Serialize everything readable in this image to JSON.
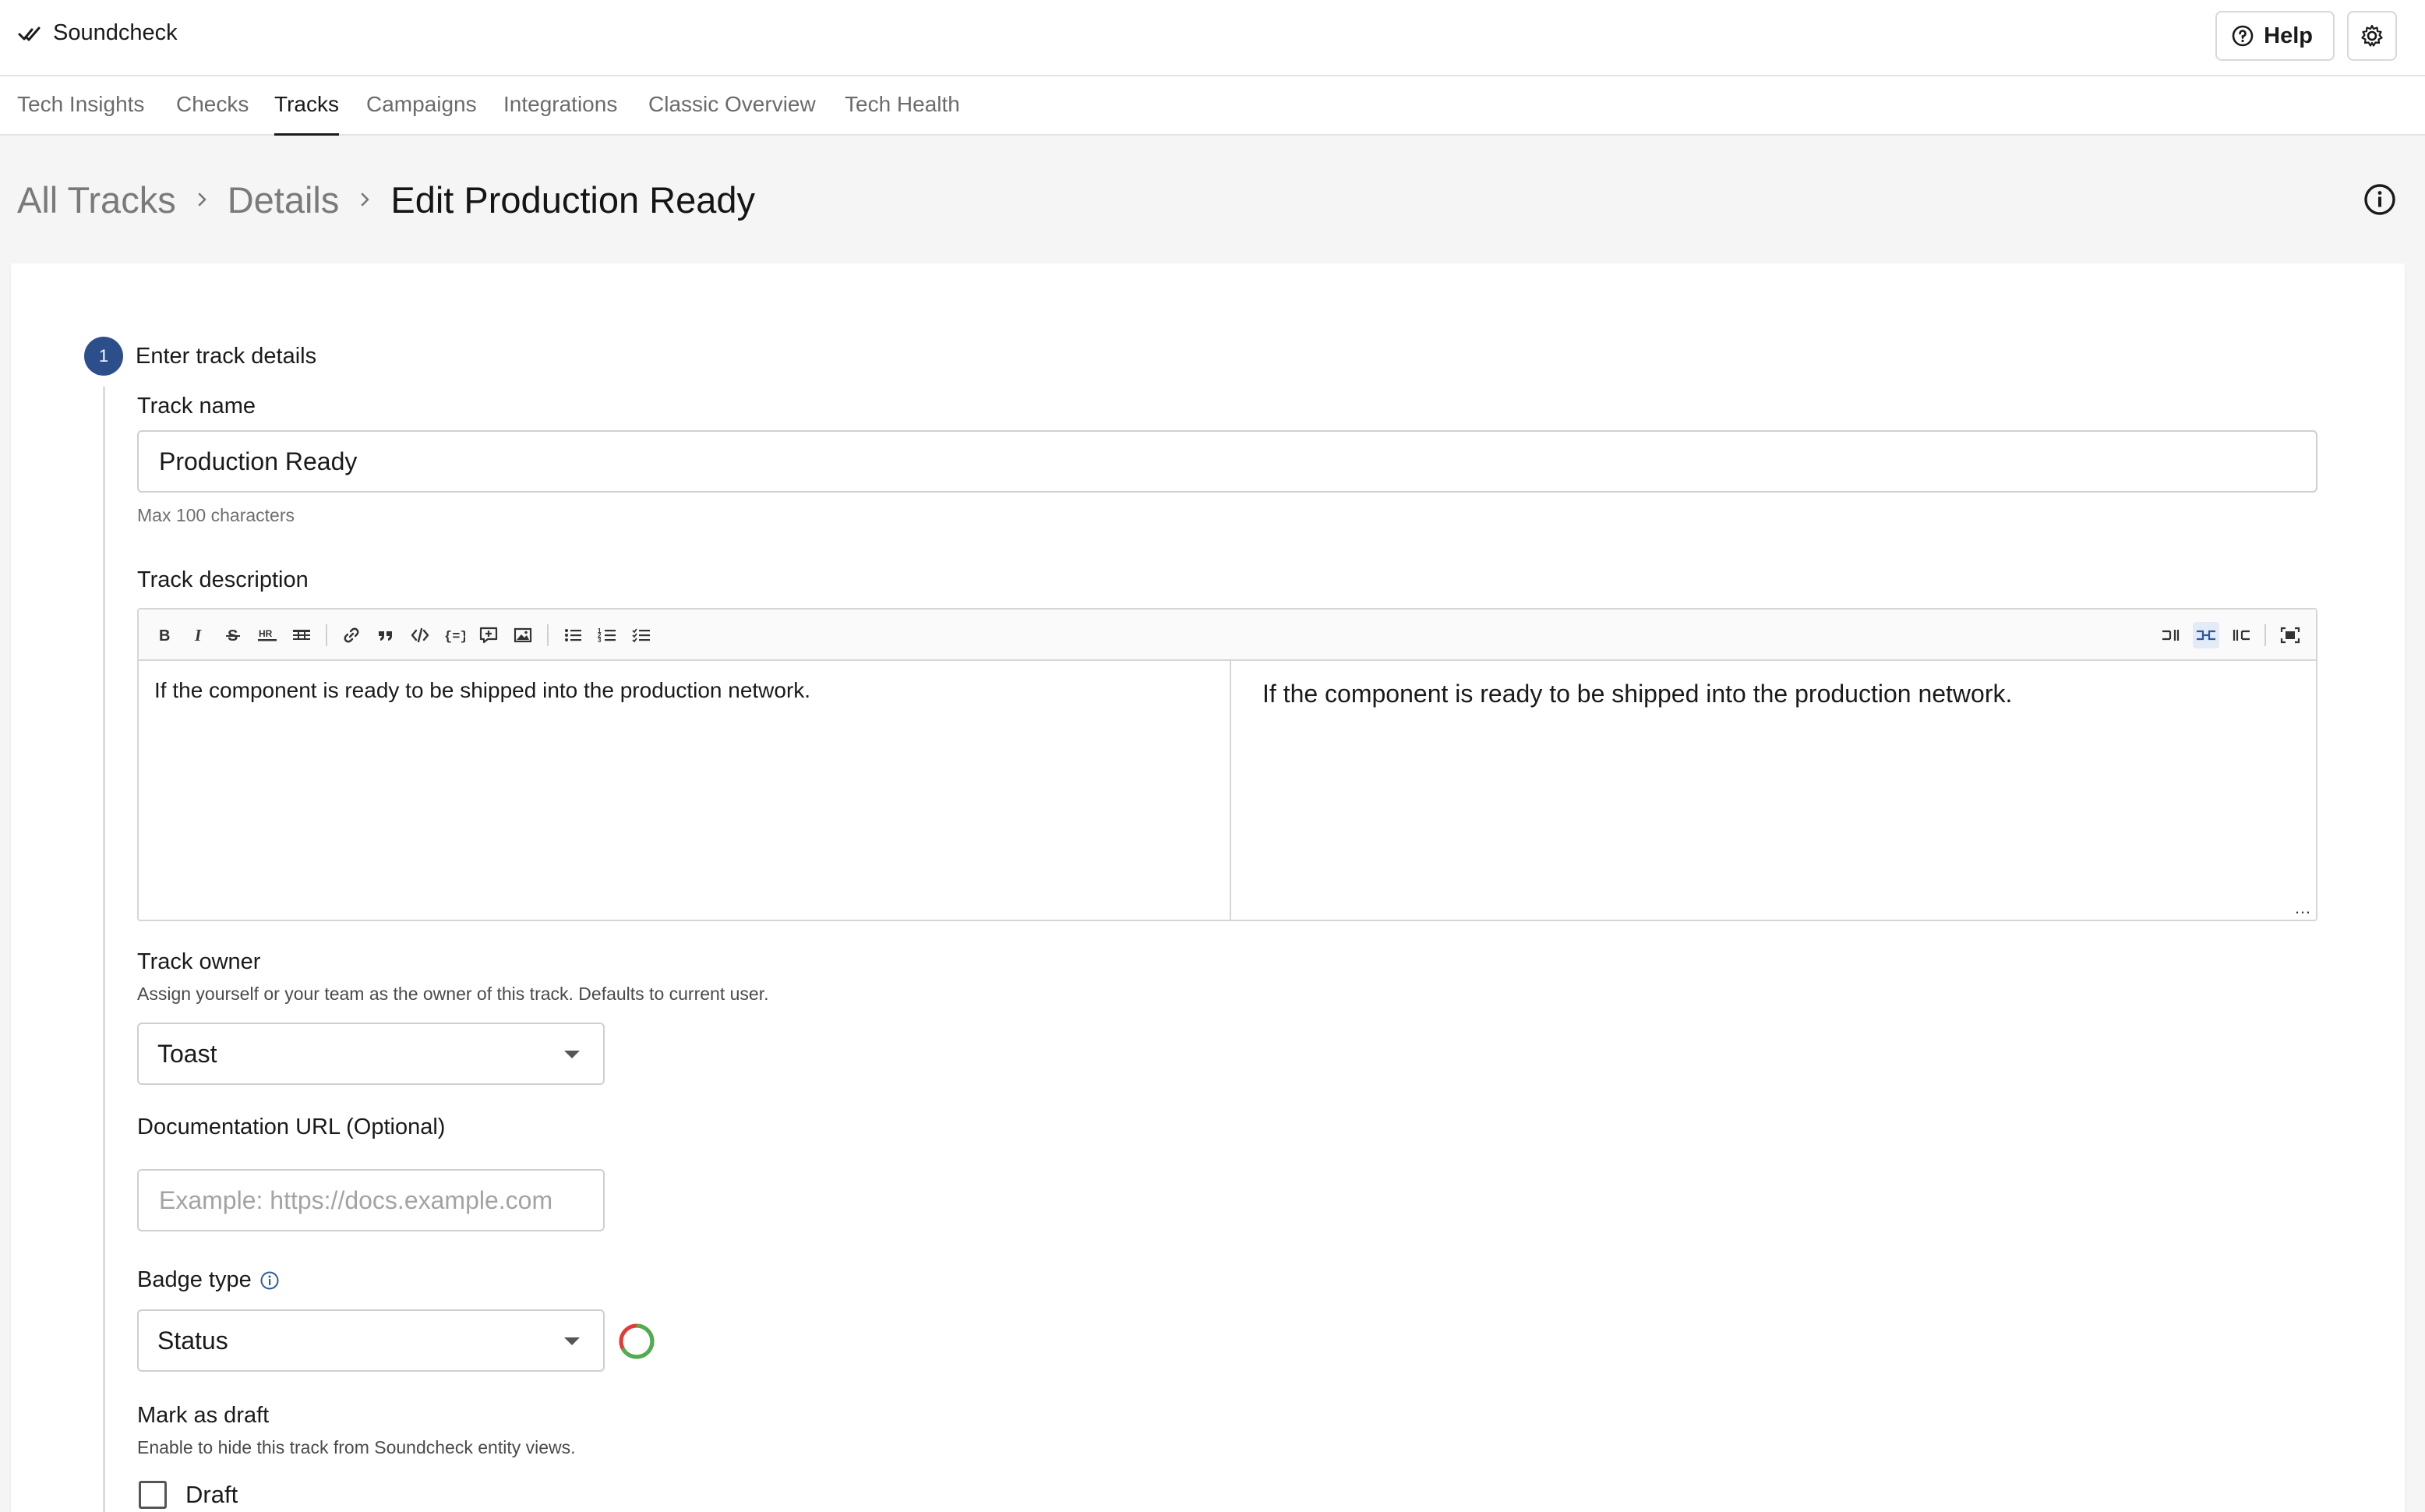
{
  "app": {
    "title": "Soundcheck",
    "help_label": "Help"
  },
  "tabs": [
    {
      "label": "Tech Insights",
      "active": false
    },
    {
      "label": "Checks",
      "active": false
    },
    {
      "label": "Tracks",
      "active": true
    },
    {
      "label": "Campaigns",
      "active": false
    },
    {
      "label": "Integrations",
      "active": false
    },
    {
      "label": "Classic Overview",
      "active": false
    },
    {
      "label": "Tech Health",
      "active": false
    }
  ],
  "breadcrumb": {
    "items": [
      "All Tracks",
      "Details"
    ],
    "current": "Edit Production Ready"
  },
  "step": {
    "number": "1",
    "title": "Enter track details"
  },
  "form": {
    "track_name": {
      "label": "Track name",
      "value": "Production Ready",
      "helper": "Max 100 characters"
    },
    "track_description": {
      "label": "Track description",
      "value": "If the component is ready to be shipped into the production network.",
      "preview": "If the component is ready to be shipped into the production network."
    },
    "track_owner": {
      "label": "Track owner",
      "helper": "Assign yourself or your team as the owner of this track. Defaults to current user.",
      "value": "Toast"
    },
    "documentation_url": {
      "label": "Documentation URL (Optional)",
      "placeholder": "Example: https://docs.example.com"
    },
    "badge_type": {
      "label": "Badge type",
      "value": "Status"
    },
    "draft": {
      "label": "Mark as draft",
      "helper": "Enable to hide this track from Soundcheck entity views.",
      "checkbox_label": "Draft",
      "checked": false
    }
  },
  "editor_toolbar": {
    "left": [
      "bold-icon",
      "italic-icon",
      "strikethrough-icon",
      "hr-icon",
      "table-icon",
      "link-icon",
      "quote-icon",
      "code-icon",
      "code-block-icon",
      "comment-icon",
      "image-icon",
      "unordered-list-icon",
      "ordered-list-icon",
      "task-list-icon"
    ],
    "right": [
      "editor-only-icon",
      "split-view-icon",
      "preview-only-icon",
      "fullscreen-icon"
    ]
  },
  "colors": {
    "accent": "#2c4f8c",
    "badge_green": "#4caf50",
    "badge_red": "#e53935"
  }
}
